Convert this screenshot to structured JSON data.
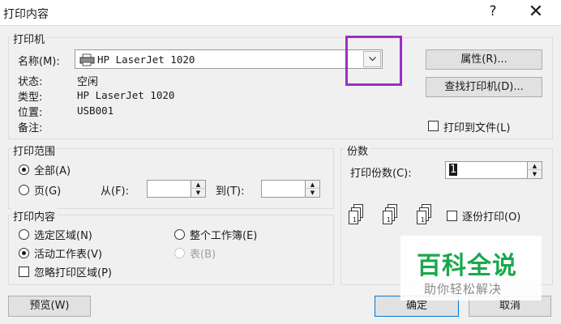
{
  "window": {
    "title": "打印内容",
    "help_icon": "?",
    "close_icon": "✕"
  },
  "printer": {
    "legend": "打印机",
    "name_label": "名称(M):",
    "name_value": "HP LaserJet 1020",
    "status_label": "状态:",
    "status_value": "空闲",
    "type_label": "类型:",
    "type_value": "HP LaserJet 1020",
    "location_label": "位置:",
    "location_value": "USB001",
    "comment_label": "备注:",
    "comment_value": "",
    "properties_button": "属性(R)...",
    "find_printer_button": "查找打印机(D)...",
    "print_to_file_label": "打印到文件(L)",
    "print_to_file_checked": false
  },
  "range": {
    "legend": "打印范围",
    "all_label": "全部(A)",
    "pages_label": "页(G)",
    "from_label": "从(F):",
    "to_label": "到(T):",
    "from_value": "",
    "to_value": "",
    "selected": "all"
  },
  "content": {
    "legend": "打印内容",
    "selection_label": "选定区域(N)",
    "active_sheets_label": "活动工作表(V)",
    "entire_workbook_label": "整个工作簿(E)",
    "table_label": "表(B)",
    "ignore_area_label": "忽略打印区域(P)",
    "selected": "active_sheets",
    "ignore_area_checked": false
  },
  "copies": {
    "legend": "份数",
    "count_label": "打印份数(C):",
    "count_value": "1",
    "collate_label": "逐份打印(O)",
    "collate_checked": false,
    "page_numbers": [
      "1",
      "2",
      "3",
      "1",
      "2",
      "3"
    ]
  },
  "footer": {
    "preview_button": "预览(W)",
    "ok_button": "确定",
    "cancel_button": "取消"
  },
  "watermark": {
    "title": "百科全说",
    "subtitle": "助你轻松解决"
  },
  "colors": {
    "highlight": "#9b2fc6",
    "watermark_green": "#1aa84d"
  }
}
